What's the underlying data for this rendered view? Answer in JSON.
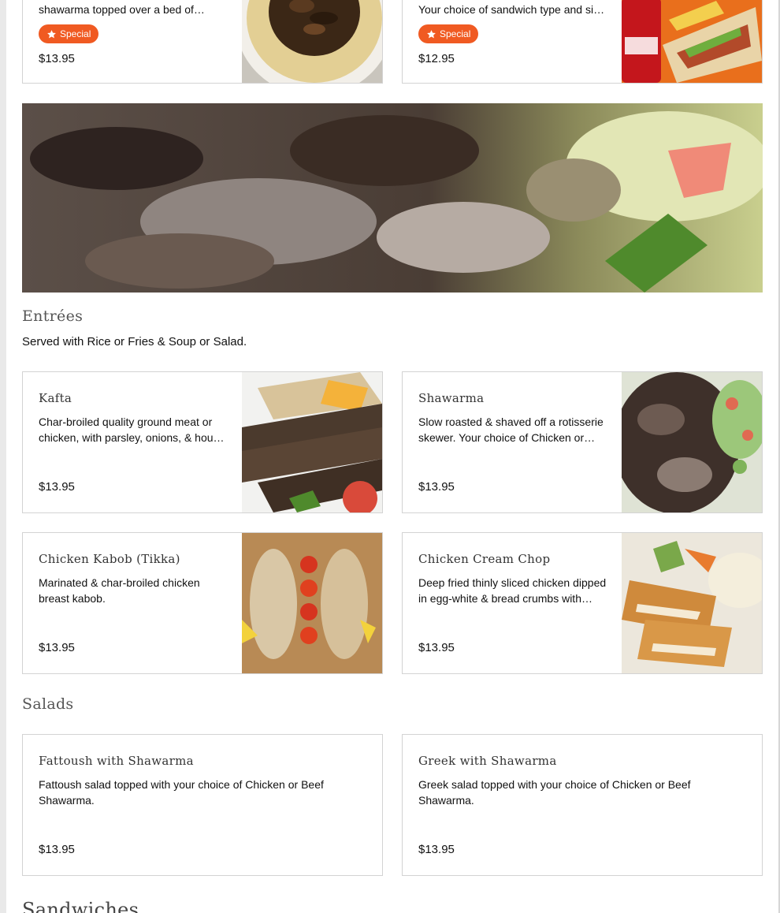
{
  "top_cards": [
    {
      "desc": "shawarma topped over a bed of hummus.",
      "badge": "Special",
      "price": "$13.95",
      "photo": "hummus-shawarma-photo"
    },
    {
      "desc": "Your choice of sandwich type and side with a drink.",
      "badge": "Special",
      "price": "$12.95",
      "photo": "wrap-combo-photo"
    }
  ],
  "banner": {
    "photo": "shawarma-banner-photo"
  },
  "entrees": {
    "title": "Entrées",
    "subtitle": "Served with Rice or Fries & Soup or Salad.",
    "items": [
      {
        "name": "Kafta",
        "desc": "Char-broiled quality ground meat or chicken, with parsley, onions, & house spices.",
        "price": "$13.95"
      },
      {
        "name": "Shawarma",
        "desc": "Slow roasted & shaved off a rotisserie skewer. Your choice of Chicken or Beef.",
        "price": "$13.95"
      },
      {
        "name": "Chicken Kabob (Tikka)",
        "desc": "Marinated & char-broiled chicken breast kabob.",
        "price": "$13.95"
      },
      {
        "name": "Chicken Cream Chop",
        "desc": "Deep fried thinly sliced chicken dipped in egg-white & bread crumbs with spices.",
        "price": "$13.95"
      }
    ]
  },
  "salads": {
    "title": "Salads",
    "items": [
      {
        "name": "Fattoush with Shawarma",
        "desc": "Fattoush salad topped with your choice of Chicken or Beef Shawarma.",
        "price": "$13.95"
      },
      {
        "name": "Greek with Shawarma",
        "desc": "Greek salad topped with your choice of Chicken or Beef Shawarma.",
        "price": "$13.95"
      }
    ]
  },
  "sandwiches": {
    "title": "Sandwiches"
  },
  "colors": {
    "accent": "#f05a22",
    "border": "#d3d3d3"
  }
}
